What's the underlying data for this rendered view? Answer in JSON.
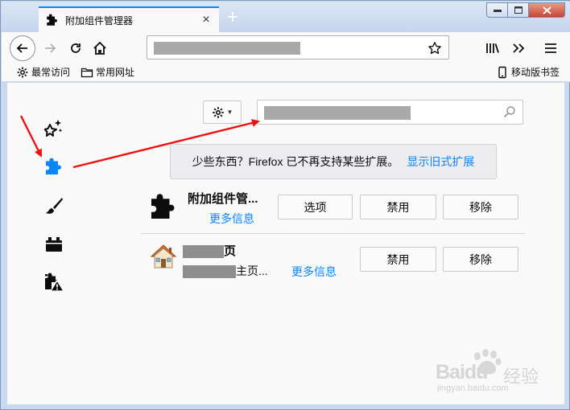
{
  "window": {
    "tab_title": "附加组件管理器",
    "tab_close_glyph": "×",
    "new_tab_glyph": "+"
  },
  "bookmarks": {
    "items": [
      {
        "label": "最常访问",
        "icon": "gear-icon"
      },
      {
        "label": "常用网址",
        "icon": "folder-icon"
      },
      {
        "label": "移动版书签",
        "icon": "mobile-icon"
      }
    ]
  },
  "addons": {
    "notice": {
      "text": "少些东西？Firefox 已不再支持某些扩展。",
      "link": "显示旧式扩展"
    },
    "extensions": [
      {
        "name": "附加组件管...",
        "more_info": "更多信息",
        "buttons": [
          "选项",
          "禁用",
          "移除"
        ]
      },
      {
        "name_suffix": "页",
        "desc_suffix": "主页...",
        "more_info": "更多信息",
        "buttons": [
          "禁用",
          "移除"
        ]
      }
    ]
  },
  "colors": {
    "accent": "#0a84ff",
    "annotation_arrow": "#ee1111"
  },
  "watermark": {
    "brand": "Baidu",
    "brand_cn": "经验",
    "url": "jingyan.baidu.com"
  }
}
